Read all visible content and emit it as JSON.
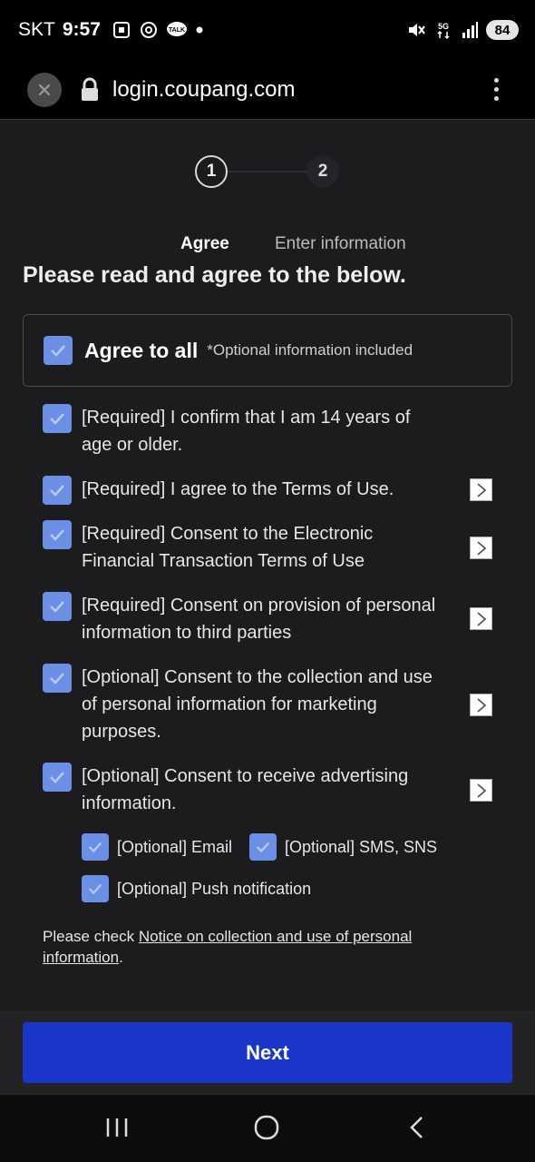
{
  "status_bar": {
    "carrier": "SKT",
    "time": "9:57",
    "network": "5G",
    "battery": "84"
  },
  "browser": {
    "url": "login.coupang.com"
  },
  "steps": [
    {
      "number": "1",
      "label": "Agree"
    },
    {
      "number": "2",
      "label": "Enter information"
    }
  ],
  "heading": "Please read and agree to the below.",
  "agree_all": {
    "label": "Agree to all",
    "note": "*Optional information included",
    "checked": true
  },
  "agreements": [
    {
      "text": "[Required] I confirm that I am 14 years of age or older.",
      "checked": true,
      "has_detail": false
    },
    {
      "text": "[Required] I agree to the Terms of Use.",
      "checked": true,
      "has_detail": true
    },
    {
      "text": "[Required] Consent to the Electronic Financial Transaction Terms of Use",
      "checked": true,
      "has_detail": true
    },
    {
      "text": "[Required] Consent on provision of personal information to third parties",
      "checked": true,
      "has_detail": true
    },
    {
      "text": "[Optional] Consent to the collection and use of personal information for marketing purposes.",
      "checked": true,
      "has_detail": true
    },
    {
      "text": "[Optional] Consent to receive advertising information.",
      "checked": true,
      "has_detail": true
    }
  ],
  "sub_options": [
    {
      "text": "[Optional] Email",
      "checked": true
    },
    {
      "text": "[Optional] SMS, SNS",
      "checked": true
    },
    {
      "text": "[Optional] Push notification",
      "checked": true
    }
  ],
  "notice": {
    "prefix": "Please check ",
    "link": "Notice on collection and use of personal information",
    "suffix": "."
  },
  "next_button": "Next",
  "colors": {
    "checkbox": "#6c8fe6",
    "primary_button": "#1a36c8",
    "background": "#1c1c1e"
  }
}
